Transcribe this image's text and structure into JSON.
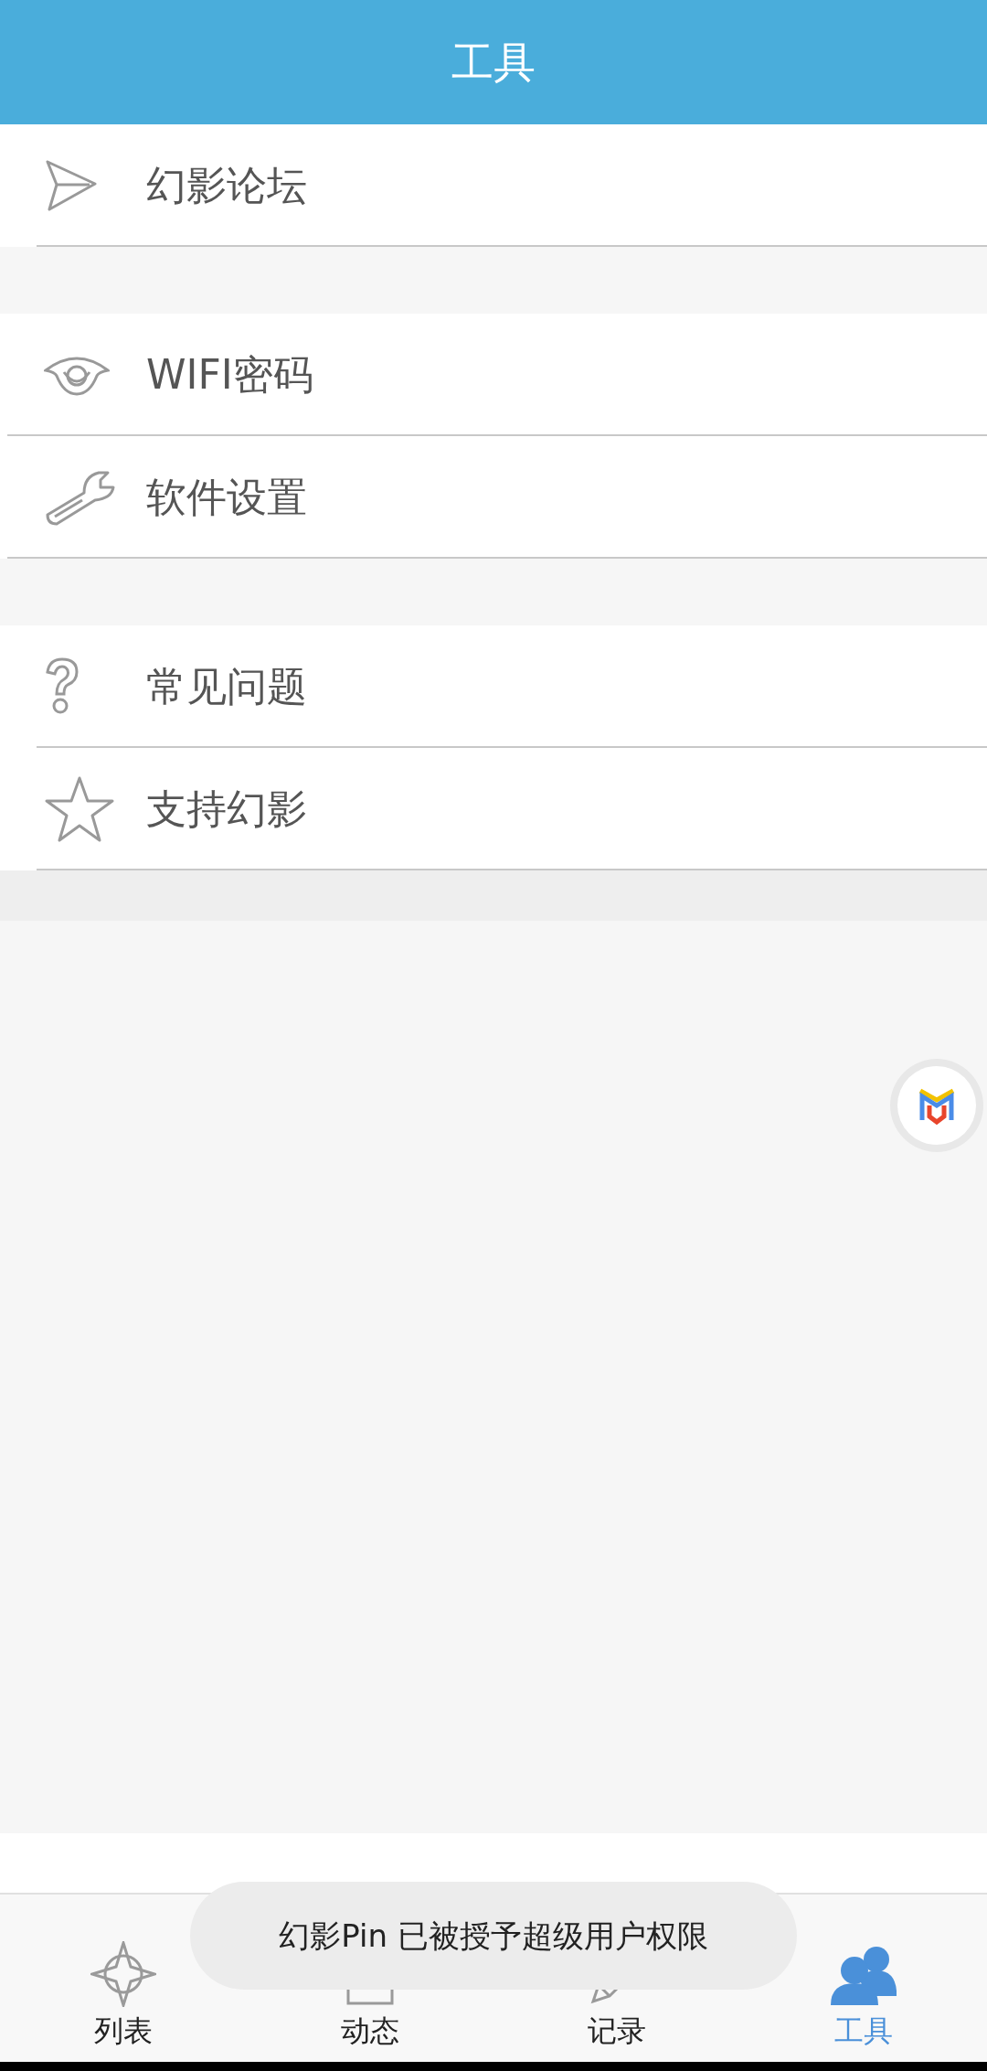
{
  "header": {
    "title": "工具"
  },
  "groups": [
    {
      "items": [
        {
          "label": "幻影论坛"
        }
      ]
    },
    {
      "items": [
        {
          "label": "WIFI密码"
        },
        {
          "label": "软件设置"
        }
      ]
    },
    {
      "items": [
        {
          "label": "常见问题"
        },
        {
          "label": "支持幻影"
        }
      ]
    }
  ],
  "tabs": [
    {
      "label": "列表",
      "selected": false
    },
    {
      "label": "动态",
      "selected": false
    },
    {
      "label": "记录",
      "selected": false
    },
    {
      "label": "工具",
      "selected": true
    }
  ],
  "toast": {
    "text": "幻影Pin 已被授予超级用户权限"
  }
}
